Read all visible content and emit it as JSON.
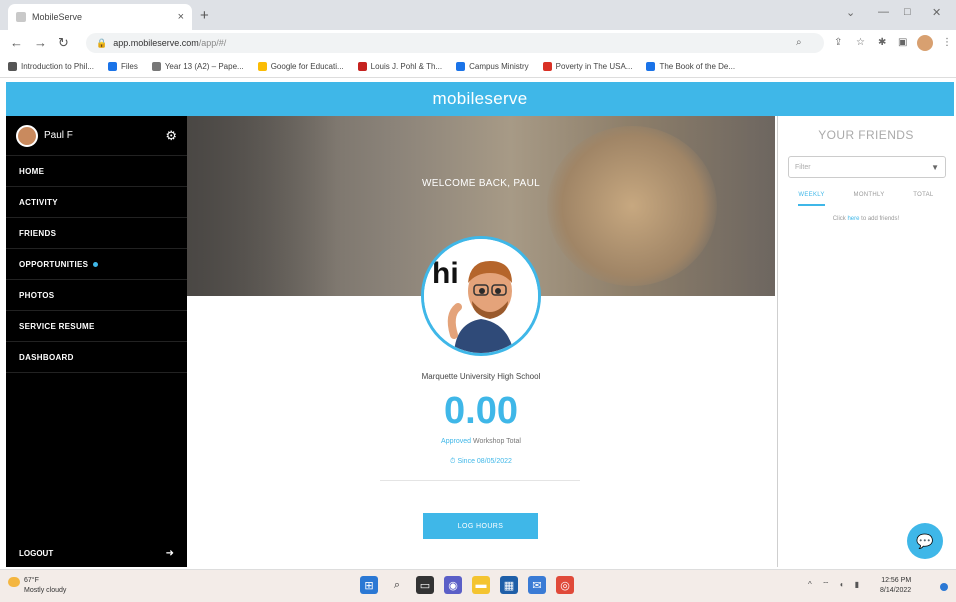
{
  "browser": {
    "tab_title": "MobileServe",
    "tab_close": "×",
    "new_tab": "+",
    "url_host": "app.mobileserve.com",
    "url_path": "/app/#/",
    "bookmarks": [
      {
        "label": "Introduction to Phil...",
        "color": "#555555"
      },
      {
        "label": "Files",
        "color": "#1a73e8"
      },
      {
        "label": "Year 13 (A2) – Pape...",
        "color": "#777777"
      },
      {
        "label": "Google for Educati...",
        "color": "#fbbc04"
      },
      {
        "label": "Louis J. Pohl & Th...",
        "color": "#c5221f"
      },
      {
        "label": "Campus Ministry",
        "color": "#1a73e8"
      },
      {
        "label": "Poverty in The USA...",
        "color": "#d93025"
      },
      {
        "label": "The Book of the De...",
        "color": "#1a73e8"
      }
    ]
  },
  "app": {
    "brand": "mobileserve",
    "accent": "#3fb7e8"
  },
  "sidebar": {
    "user_name": "Paul F",
    "items": [
      {
        "label": "HOME"
      },
      {
        "label": "ACTIVITY"
      },
      {
        "label": "FRIENDS"
      },
      {
        "label": "OPPORTUNITIES"
      },
      {
        "label": "PHOTOS"
      },
      {
        "label": "SERVICE RESUME"
      },
      {
        "label": "DASHBOARD"
      }
    ],
    "logout_label": "LOGOUT"
  },
  "main": {
    "welcome": "WELCOME BACK, PAUL",
    "avatar_caption": "hi",
    "school": "Marquette University High School",
    "hours": "0.00",
    "approved_word": "Approved",
    "approved_rest": " Workshop Total",
    "since": "⏱ Since 08/05/2022",
    "log_button": "LOG HOURS"
  },
  "friends_panel": {
    "title": "YOUR FRIENDS",
    "filter_placeholder": "Filter",
    "tabs": [
      {
        "label": "WEEKLY"
      },
      {
        "label": "MONTHLY"
      },
      {
        "label": "TOTAL"
      }
    ],
    "hint_prefix": "Click ",
    "hint_link": "here",
    "hint_suffix": " to add friends!"
  },
  "taskbar": {
    "temp": "67°F",
    "weather": "Mostly cloudy",
    "time": "12:56 PM",
    "date": "8/14/2022"
  }
}
